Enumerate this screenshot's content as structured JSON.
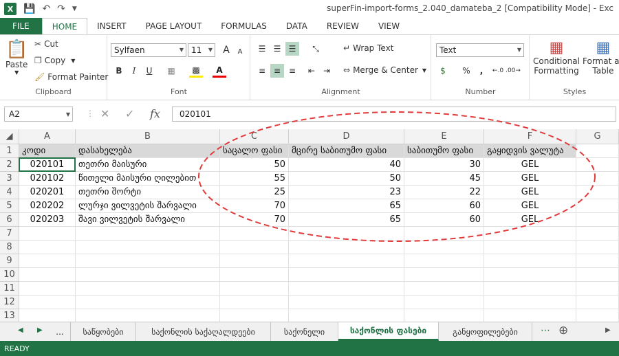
{
  "window": {
    "title": "superFin-import-forms_2.040_damateba_2  [Compatibility Mode] - Exc",
    "app_icon": "X"
  },
  "ribbon_tabs": [
    "FILE",
    "HOME",
    "INSERT",
    "PAGE LAYOUT",
    "FORMULAS",
    "DATA",
    "REVIEW",
    "VIEW"
  ],
  "clipboard": {
    "paste": "Paste",
    "cut": "Cut",
    "copy": "Copy",
    "format_painter": "Format Painter",
    "label": "Clipboard"
  },
  "font": {
    "name": "Sylfaen",
    "size": "11",
    "label": "Font",
    "bold": "B",
    "italic": "I",
    "underline": "U",
    "grow": "A",
    "shrink": "A",
    "font_color": "A"
  },
  "alignment": {
    "wrap_text": "Wrap Text",
    "merge_center": "Merge & Center",
    "label": "Alignment"
  },
  "number": {
    "format": "Text",
    "currency": "$",
    "percent": "%",
    "comma": ",",
    "label": "Number"
  },
  "styles": {
    "conditional_1": "Conditional",
    "conditional_2": "Formatting",
    "format_as_1": "Format as",
    "format_as_2": "Table",
    "label": "Styles"
  },
  "formula_bar": {
    "name_box": "A2",
    "value": "020101",
    "fx": "fx"
  },
  "columns": [
    "A",
    "B",
    "C",
    "D",
    "E",
    "F",
    "G"
  ],
  "rows": [
    "1",
    "2",
    "3",
    "4",
    "5",
    "6",
    "7",
    "8",
    "9",
    "10",
    "11",
    "12",
    "13"
  ],
  "table": {
    "headers": [
      "კოდი",
      "დასახელება",
      "საცალო ფასი",
      "მცირე საბითუმო ფასი",
      "საბითუმო ფასი",
      "გაყიდვის ვალუტა"
    ],
    "rows": [
      [
        "020101",
        "თეთრი მაისური",
        "50",
        "40",
        "30",
        "GEL"
      ],
      [
        "020102",
        "წითელი მაისური ღილებით",
        "55",
        "50",
        "45",
        "GEL"
      ],
      [
        "020201",
        "თეთრი შორტი",
        "25",
        "23",
        "22",
        "GEL"
      ],
      [
        "020202",
        "ლურჯი ვილვეტის შარვალი",
        "70",
        "65",
        "60",
        "GEL"
      ],
      [
        "020203",
        "შავი ვილვეტის შარვალი",
        "70",
        "65",
        "60",
        "GEL"
      ]
    ]
  },
  "sheet_tabs": [
    "...",
    "საწყობები",
    "საქონლის საქაღალდეები",
    "საქონელი",
    "საქონლის ფასები",
    "განყოფილებები"
  ],
  "active_sheet": "საქონლის ფასები",
  "status": "READY",
  "colors": {
    "excel_green": "#217346",
    "annotation_red": "#e03a3a",
    "header_fill": "#d9d9d9"
  }
}
